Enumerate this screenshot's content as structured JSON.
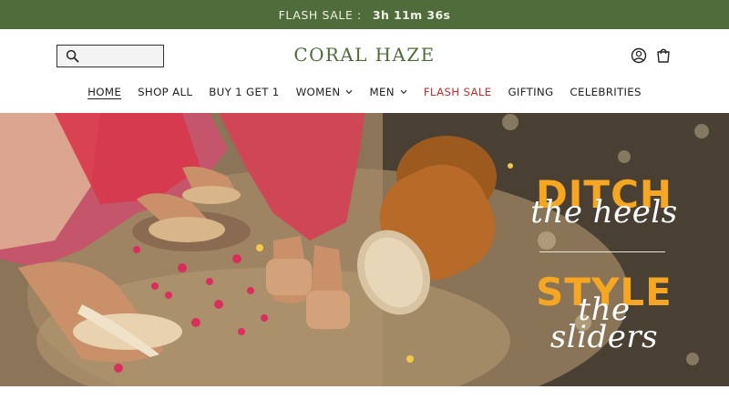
{
  "announcement": {
    "label": "FLASH SALE :",
    "timer": "3h 11m 36s"
  },
  "header": {
    "logo": "CORAL HAZE",
    "search_placeholder": "",
    "icons": [
      "search-icon",
      "account-icon",
      "cart-icon"
    ]
  },
  "nav": {
    "items": [
      {
        "label": "HOME",
        "active": true
      },
      {
        "label": "SHOP ALL"
      },
      {
        "label": "BUY 1 GET 1"
      },
      {
        "label": "WOMEN",
        "dropdown": true
      },
      {
        "label": "MEN",
        "dropdown": true
      },
      {
        "label": "FLASH SALE",
        "highlight": true
      },
      {
        "label": "GIFTING"
      },
      {
        "label": "CELEBRITIES"
      }
    ]
  },
  "hero": {
    "line1_bold": "DITCH",
    "line1_script": "the heels",
    "line2_bold": "STYLE",
    "line2_script": "the sliders"
  },
  "colors": {
    "brand_green": "#4f6c3a",
    "sale_red": "#c92a2a",
    "hero_orange": "#f5a623"
  }
}
